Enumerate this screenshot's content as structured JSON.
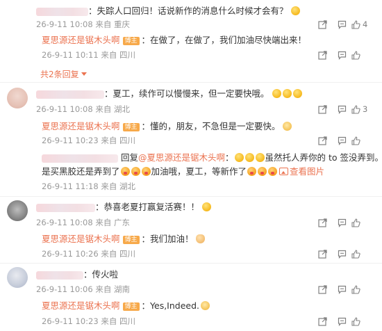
{
  "icons": {
    "share": "share-icon",
    "comment": "comment-icon",
    "like": "thumbs-up-icon"
  },
  "colors": {
    "author_link": "#eb7350",
    "badge_bg": "#f7a94a",
    "meta_gray": "#999999"
  },
  "comments": [
    {
      "user": "",
      "text": "：失踪人口回归！话说新作的消息什么时候才会有？",
      "meta": "26-9-11 10:08 来自 重庆",
      "likes": "4",
      "reply": {
        "author": "夏思源还是锯木头啊",
        "badge": "博主",
        "text": "：在做了，在做了，我们加油尽快端出来！",
        "meta": "26-9-11 10:11 来自 四川"
      },
      "more_replies": "共2条回复"
    },
    {
      "user": "",
      "text": "：夏工，续作可以慢慢来，但一定要快哦。",
      "meta": "26-9-11 10:08 来自 湖北",
      "likes": "3",
      "reply": {
        "author": "夏思源还是锯木头啊",
        "badge": "博主",
        "text": "：懂的，朋友，不急但是一定要快。",
        "meta": "26-9-11 10:23 来自 四川"
      },
      "reply2": {
        "user": "",
        "reply_kw": "回复",
        "at": "@夏思源还是锯木头啊",
        "text1": "：",
        "text1b": "虽然托人弄你的 to 签没弄到。但",
        "text2a": "是买黑胶还是弄到了",
        "text2b": "加油哦，夏工，等新作了",
        "view_image": "查看图片",
        "meta": "26-9-11 11:18 来自 湖北"
      }
    },
    {
      "user": "",
      "text": "：恭喜老夏打赢复活赛！！",
      "meta": "26-9-11 10:08 来自 广东",
      "likes": "",
      "reply": {
        "author": "夏思源还是锯木头啊",
        "badge": "博主",
        "text": "：我们加油！",
        "meta": "26-9-11 10:26 来自 四川"
      }
    },
    {
      "user": "",
      "text": "：传火啦",
      "meta": "26-9-11 10:06 来自 湖南",
      "likes": "",
      "reply": {
        "author": "夏思源还是锯木头啊",
        "badge": "博主",
        "text": "：Yes,Indeed.",
        "meta": "26-9-11 10:23 来自 四川"
      }
    }
  ]
}
